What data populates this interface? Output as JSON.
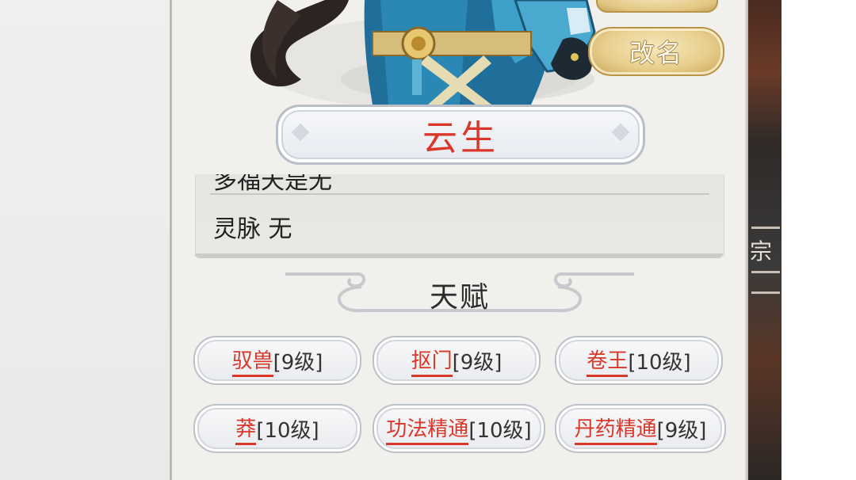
{
  "header": {
    "rename_label": "改名",
    "character_name": "云生"
  },
  "attributes": {
    "cut_row": "多福天是无",
    "lingmai": "灵脉 无"
  },
  "talents": {
    "title": "天赋",
    "items": [
      {
        "name": "驭兽",
        "level": "[9级]"
      },
      {
        "name": "抠门",
        "level": "[9级]"
      },
      {
        "name": "卷王",
        "level": "[10级]"
      },
      {
        "name": "莽",
        "level": "[10级]"
      },
      {
        "name": "功法精通",
        "level": "[10级]"
      },
      {
        "name": "丹药精通",
        "level": "[9级]"
      }
    ]
  },
  "background": {
    "strip_char": "宗"
  },
  "colors": {
    "accent_red": "#d9372a",
    "gold": "#e8cf8e",
    "panel_bg": "#f1f0ed"
  }
}
